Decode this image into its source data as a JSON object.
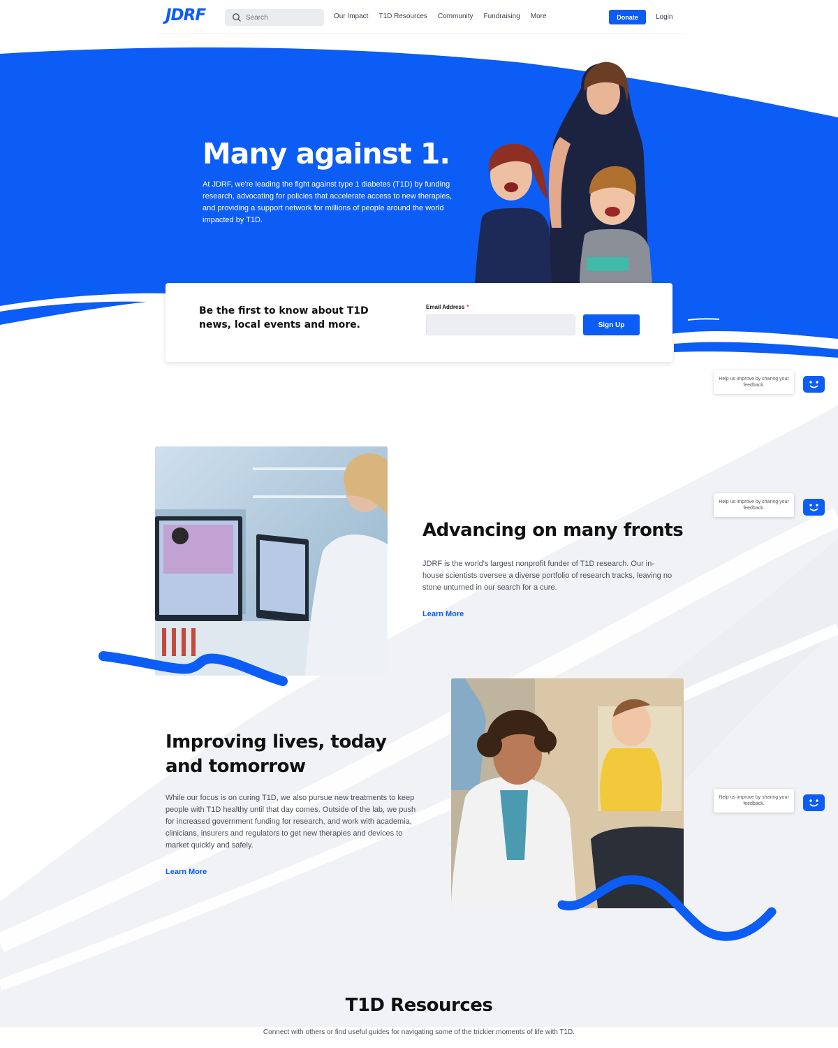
{
  "nav": {
    "logo": "JDRF",
    "search_placeholder": "Search",
    "links": [
      "Our Impact",
      "T1D Resources",
      "Community",
      "Fundraising",
      "More"
    ],
    "donate_label": "Donate",
    "login_label": "Login"
  },
  "hero": {
    "title": "Many against 1.",
    "text": "At JDRF, we're leading the fight against type 1 diabetes (T1D) by funding research, advocating for policies that accelerate access to new therapies, and providing a support network for millions of people around the world impacted by T1D."
  },
  "signup": {
    "heading": "Be the first to know about T1D news, local events and more.",
    "email_label": "Email Address",
    "required_mark": "*",
    "email_value": "",
    "button_label": "Sign Up"
  },
  "feedback": {
    "text": "Help us improve by sharing your feedback."
  },
  "feature1": {
    "title": "Advancing on many fronts",
    "text": "JDRF is the world's largest nonprofit funder of T1D research. Our in-house scientists oversee a diverse portfolio of research tracks, leaving no stone unturned in our search for a cure.",
    "link": "Learn More"
  },
  "feature2": {
    "title": "Improving lives, today and tomorrow",
    "text": "While our focus is on curing T1D, we also pursue new treatments to keep people with T1D healthy until that day comes. Outside of the lab, we push for increased government funding for research, and work with academia, clinicians, insurers and regulators to get new therapies and devices to market quickly and safely.",
    "link": "Learn More"
  },
  "resources": {
    "title": "T1D Resources",
    "text": "Connect with others or find useful guides for navigating some of the trickier moments of life with T1D."
  },
  "colors": {
    "brand_blue": "#0c5cf6",
    "text_dark": "#111111",
    "grey_bg": "#f1f2f5"
  }
}
